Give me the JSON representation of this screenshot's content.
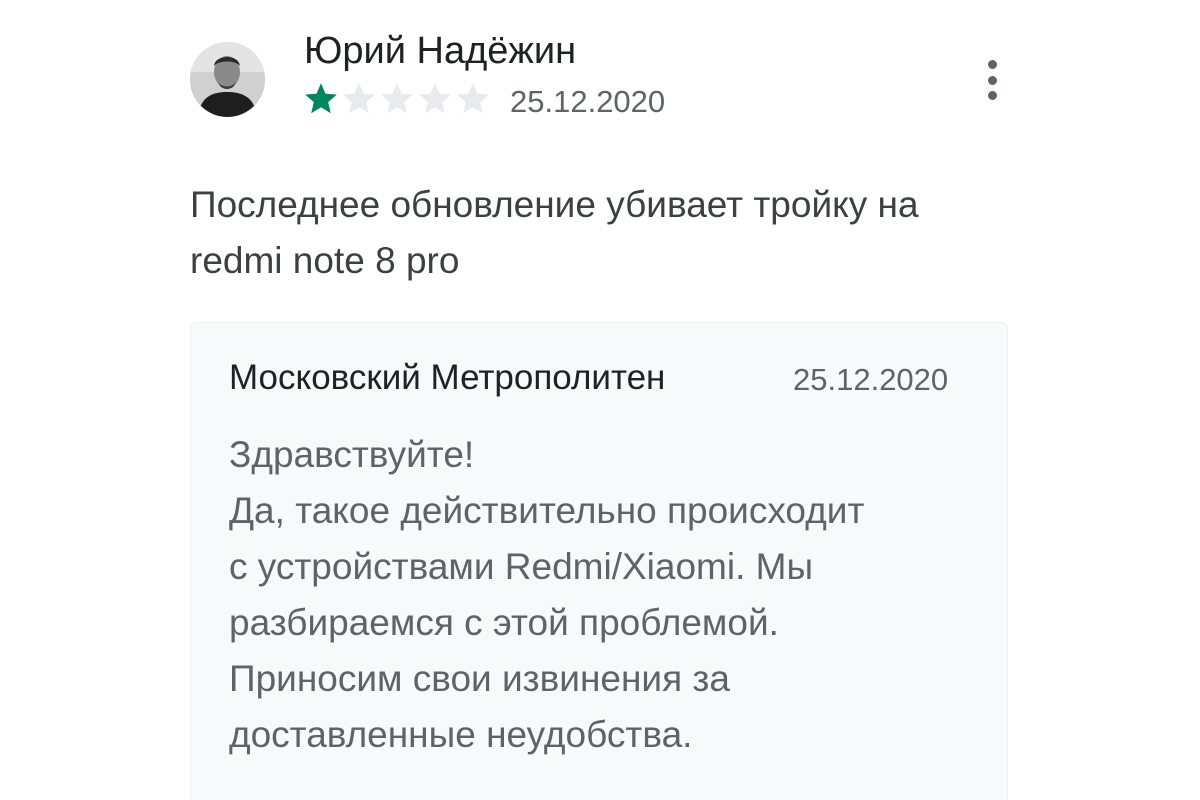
{
  "review": {
    "author": "Юрий Надёжин",
    "rating": 1,
    "max_rating": 5,
    "date": "25.12.2020",
    "text": "Последнее обновление убивает тройку на\nredmi note 8 pro",
    "menu_icon": "more-vert-icon"
  },
  "reply": {
    "author": "Московский Метрополитен",
    "date": "25.12.2020",
    "text": "Здравствуйте!\nДа, такое действительно происходит\nс устройствами Redmi/Xiaomi. Мы\nразбираемся с этой проблемой.\nПриносим свои извинения за\nдоставленные неудобства."
  },
  "colors": {
    "star_filled": "#01875f",
    "star_empty": "#e8eaed"
  }
}
